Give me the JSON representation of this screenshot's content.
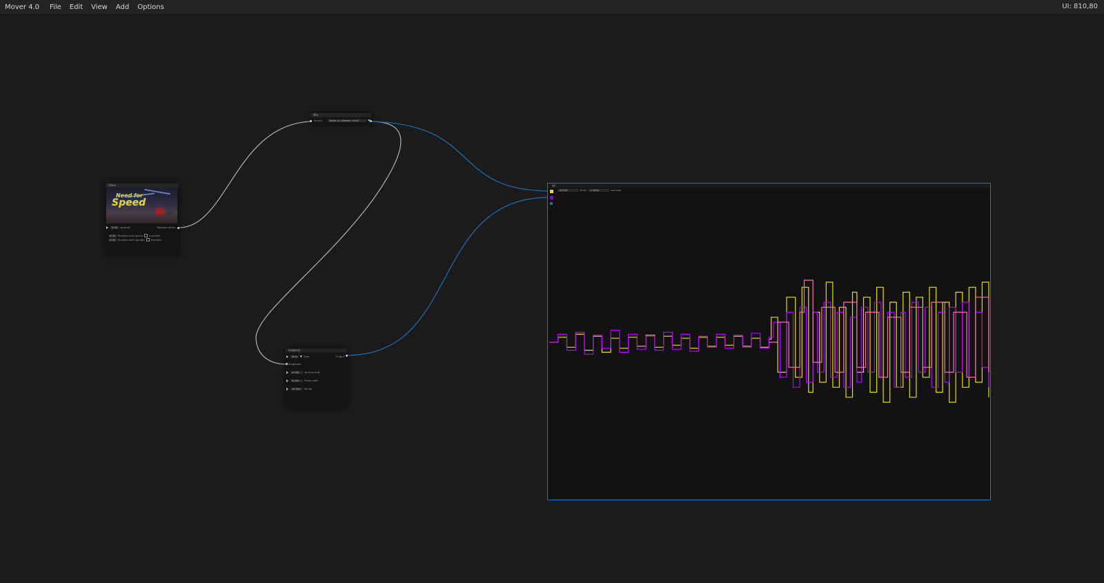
{
  "app": {
    "title": "Mover 4.0",
    "menus": [
      "File",
      "Edit",
      "View",
      "Add",
      "Options"
    ],
    "ui_readout": "UI: 810,80"
  },
  "colors": {
    "background": "#1b1b1b",
    "menubar": "#232323",
    "wire_gray": "#a9a9a9",
    "wire_blue": "#1e6aa8",
    "selection": "#1677c4",
    "series_yellow": "#e8e000",
    "series_magenta": "#b400ff",
    "series_pink": "#ff6fa8"
  },
  "nodes": {
    "video": {
      "header": "Video",
      "thumbnail_word_1": "Need for",
      "thumbnail_word_2": "Speed",
      "row1_value": "0.00",
      "row1_label": "seconds",
      "row1_output": "Random series",
      "row2_value": "0.00",
      "row2_label": "Random part (pitch)",
      "row2_check_label": "Inverted",
      "row3_value": "0.00",
      "row3_label": "Random part (gauge)",
      "row3_check_label": "Inverted"
    },
    "mix": {
      "header": "Mix",
      "source_label": "Source",
      "source_value": "Noise (x, phasors, sin/c)"
    },
    "lowpass": {
      "header": "Lowpass",
      "type_value": "Sine",
      "type_label": "Type",
      "output_label": "Output",
      "amplitude_label": "Amplitude",
      "vertical_shift_value": "0.000",
      "vertical_shift_label": "Vertical shift",
      "phase_shift_value": "0.000",
      "phase_shift_label": "Phase shift",
      "period_value": "10.000",
      "period_label": "Period"
    },
    "plot": {
      "header": "XY",
      "field1_value": "100.00",
      "field1_label": "Width",
      "field2_value": "1.0000",
      "field2_label": "seconds"
    }
  },
  "icons": [
    "triangle-input-icon",
    "port-icon",
    "checkbox-icon",
    "dropdown-icon"
  ],
  "chart_data": {
    "type": "line",
    "title": "",
    "xlabel": "",
    "ylabel": "",
    "xlim": [
      0,
      1
    ],
    "ylim": [
      -1,
      1
    ],
    "grid": false,
    "legend": "none",
    "series": [
      {
        "color": "#e8e000",
        "x": [
          0,
          0.02,
          0.04,
          0.06,
          0.08,
          0.1,
          0.12,
          0.14,
          0.16,
          0.18,
          0.2,
          0.22,
          0.24,
          0.26,
          0.28,
          0.3,
          0.32,
          0.34,
          0.36,
          0.38,
          0.4,
          0.42,
          0.44,
          0.46,
          0.48,
          0.5,
          0.505,
          0.52,
          0.54,
          0.56,
          0.575,
          0.59,
          0.6,
          0.615,
          0.63,
          0.645,
          0.66,
          0.675,
          0.69,
          0.7,
          0.715,
          0.73,
          0.745,
          0.76,
          0.775,
          0.79,
          0.805,
          0.82,
          0.835,
          0.85,
          0.865,
          0.88,
          0.895,
          0.91,
          0.925,
          0.94,
          0.955,
          0.97,
          0.985,
          1
        ],
        "y": [
          0,
          0.05,
          -0.05,
          0.08,
          -0.08,
          0.06,
          -0.1,
          0.04,
          -0.06,
          0.05,
          -0.04,
          0.07,
          -0.05,
          0.06,
          -0.03,
          0.04,
          -0.06,
          0.05,
          -0.04,
          0.05,
          -0.03,
          0.06,
          -0.04,
          0.04,
          -0.05,
          0.03,
          0.25,
          -0.3,
          0.45,
          -0.35,
          0.55,
          -0.5,
          0.3,
          -0.4,
          0.6,
          -0.45,
          0.35,
          -0.55,
          0.5,
          -0.3,
          0.45,
          -0.5,
          0.55,
          -0.6,
          0.4,
          -0.45,
          0.5,
          -0.55,
          0.45,
          -0.35,
          0.55,
          -0.5,
          0.4,
          -0.6,
          0.5,
          -0.45,
          0.55,
          -0.4,
          0.6,
          -0.55
        ]
      },
      {
        "color": "#b400ff",
        "x": [
          0,
          0.02,
          0.04,
          0.06,
          0.08,
          0.1,
          0.12,
          0.14,
          0.16,
          0.18,
          0.2,
          0.22,
          0.24,
          0.26,
          0.28,
          0.3,
          0.32,
          0.34,
          0.36,
          0.38,
          0.4,
          0.42,
          0.44,
          0.46,
          0.48,
          0.5,
          0.51,
          0.525,
          0.54,
          0.555,
          0.57,
          0.585,
          0.6,
          0.61,
          0.625,
          0.64,
          0.655,
          0.67,
          0.685,
          0.7,
          0.71,
          0.725,
          0.74,
          0.755,
          0.77,
          0.785,
          0.8,
          0.81,
          0.825,
          0.84,
          0.855,
          0.87,
          0.885,
          0.9,
          0.91,
          0.925,
          0.94,
          0.955,
          0.97,
          0.985,
          1
        ],
        "y": [
          0,
          0.08,
          -0.08,
          0.1,
          -0.12,
          0.07,
          -0.06,
          0.12,
          -0.1,
          0.08,
          -0.07,
          0.06,
          -0.08,
          0.1,
          -0.07,
          0.08,
          -0.09,
          0.06,
          -0.05,
          0.08,
          -0.06,
          0.07,
          -0.05,
          0.09,
          -0.06,
          0.05,
          0.2,
          -0.35,
          0.3,
          -0.45,
          0.35,
          -0.4,
          0.3,
          -0.3,
          0.4,
          -0.35,
          0.3,
          -0.45,
          0.25,
          -0.4,
          0.35,
          -0.3,
          0.4,
          -0.35,
          0.3,
          -0.45,
          0.3,
          -0.35,
          0.4,
          -0.3,
          0.35,
          -0.45,
          0.3,
          -0.4,
          0.35,
          -0.3,
          0.4,
          -0.35,
          0.3,
          -0.25,
          -0.45
        ]
      },
      {
        "color": "#ff6fa8",
        "x": [
          0.5,
          0.52,
          0.545,
          0.57,
          0.58,
          0.6,
          0.62,
          0.65,
          0.67,
          0.7,
          0.72,
          0.75,
          0.77,
          0.8,
          0.82,
          0.85,
          0.87,
          0.9,
          0.92,
          0.95,
          0.97,
          1
        ],
        "y": [
          0,
          0.2,
          -0.25,
          0.3,
          0.62,
          -0.2,
          0.35,
          -0.3,
          0.4,
          -0.25,
          0.3,
          -0.35,
          0.25,
          -0.3,
          0.35,
          -0.25,
          0.4,
          -0.3,
          0.3,
          -0.35,
          0.45,
          -0.3
        ]
      }
    ]
  }
}
